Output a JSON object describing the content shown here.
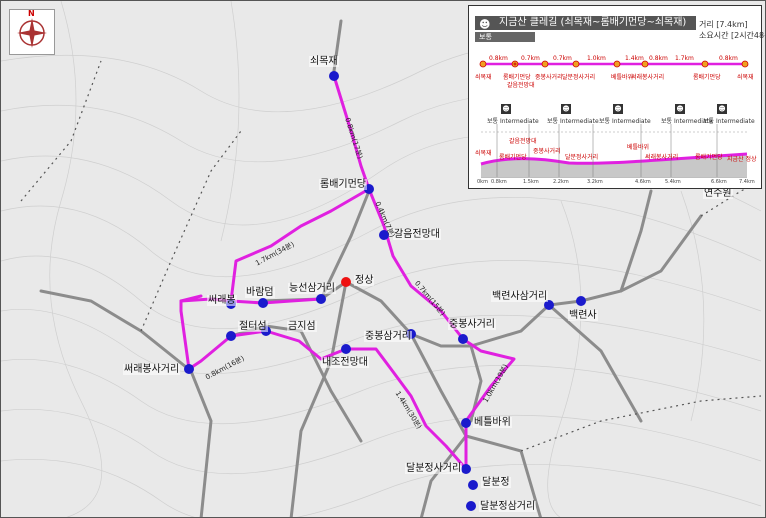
{
  "trail": {
    "title": "지금산 클레길 (쇠목재~롬배기먼당~쇠목재)",
    "difficulty": "보통 Intermediate",
    "distance": "거리 [7.4km]",
    "duration": "소요시간 [2시간48분]"
  },
  "places": {
    "soemokjae": "쇠목재",
    "rombaegi": "롬배기먼당",
    "galeum": "갈음전망대",
    "jeongsang": "정상",
    "neungseon": "능선삼거리",
    "baram": "바람덤",
    "ssaraebong": "써래봉",
    "jeolteo": "절터섬",
    "geumji": "금지섬",
    "ssaraebong_sa": "써래봉사거리",
    "jungbong_sam": "중봉삼거리",
    "jungbong_sa": "중봉사거리",
    "baekryeon_sam": "백련사삼거리",
    "baekryeonsa": "백련사",
    "naejo": "내조전망대",
    "betteul": "베틀바위",
    "dalbong_sa": "달분정사거리",
    "dalbong": "달분정",
    "dalbong_sam": "달분정삼거리",
    "yeonsuwon": "연수원"
  },
  "segments": {
    "s1": "0.8km(17분)",
    "s2": "0.4km(7분)",
    "s3": "0.7km(15분)",
    "s4": "1.0km(19분)",
    "s5": "1.4km(30분)",
    "s6": "0.8km(16분)",
    "s7": "1.7km(34분)"
  },
  "legend": {
    "stops_top": [
      "쇠목재",
      "롬배기먼당",
      "갈음전망대",
      "중봉사거리",
      "달분정사거리",
      "베틀바위",
      "써래봉사거리",
      "롬배기먼당",
      "쇠목재"
    ],
    "dists": [
      "0.8km",
      "0.7km",
      "0.7km",
      "1.0km",
      "1.4km",
      "0.8km",
      "1.7km",
      "0.8km"
    ],
    "levels": [
      "보통 Intermediate",
      "보통 Intermediate",
      "보통 Intermediate",
      "보통 Intermediate",
      "보통 Intermediate"
    ],
    "profile_labels": [
      "쇠목재",
      "롬배기먼당",
      "갈음전망대",
      "중봉사거리",
      "달분정사거리",
      "베틀바위",
      "써래봉사거리",
      "롬배기먼당",
      "지금산 정상"
    ],
    "axis": [
      "0km",
      "0.8km",
      "1.5km",
      "2.2km",
      "3.2km",
      "4.6km",
      "5.4km",
      "6.6km",
      "7.4km"
    ]
  },
  "compass": {
    "n": "N"
  },
  "colors": {
    "route": "#e020e0",
    "road": "#8c8c8c",
    "point": "#1a1acc",
    "peak": "#ee1111",
    "contour": "#c9c9c9"
  }
}
